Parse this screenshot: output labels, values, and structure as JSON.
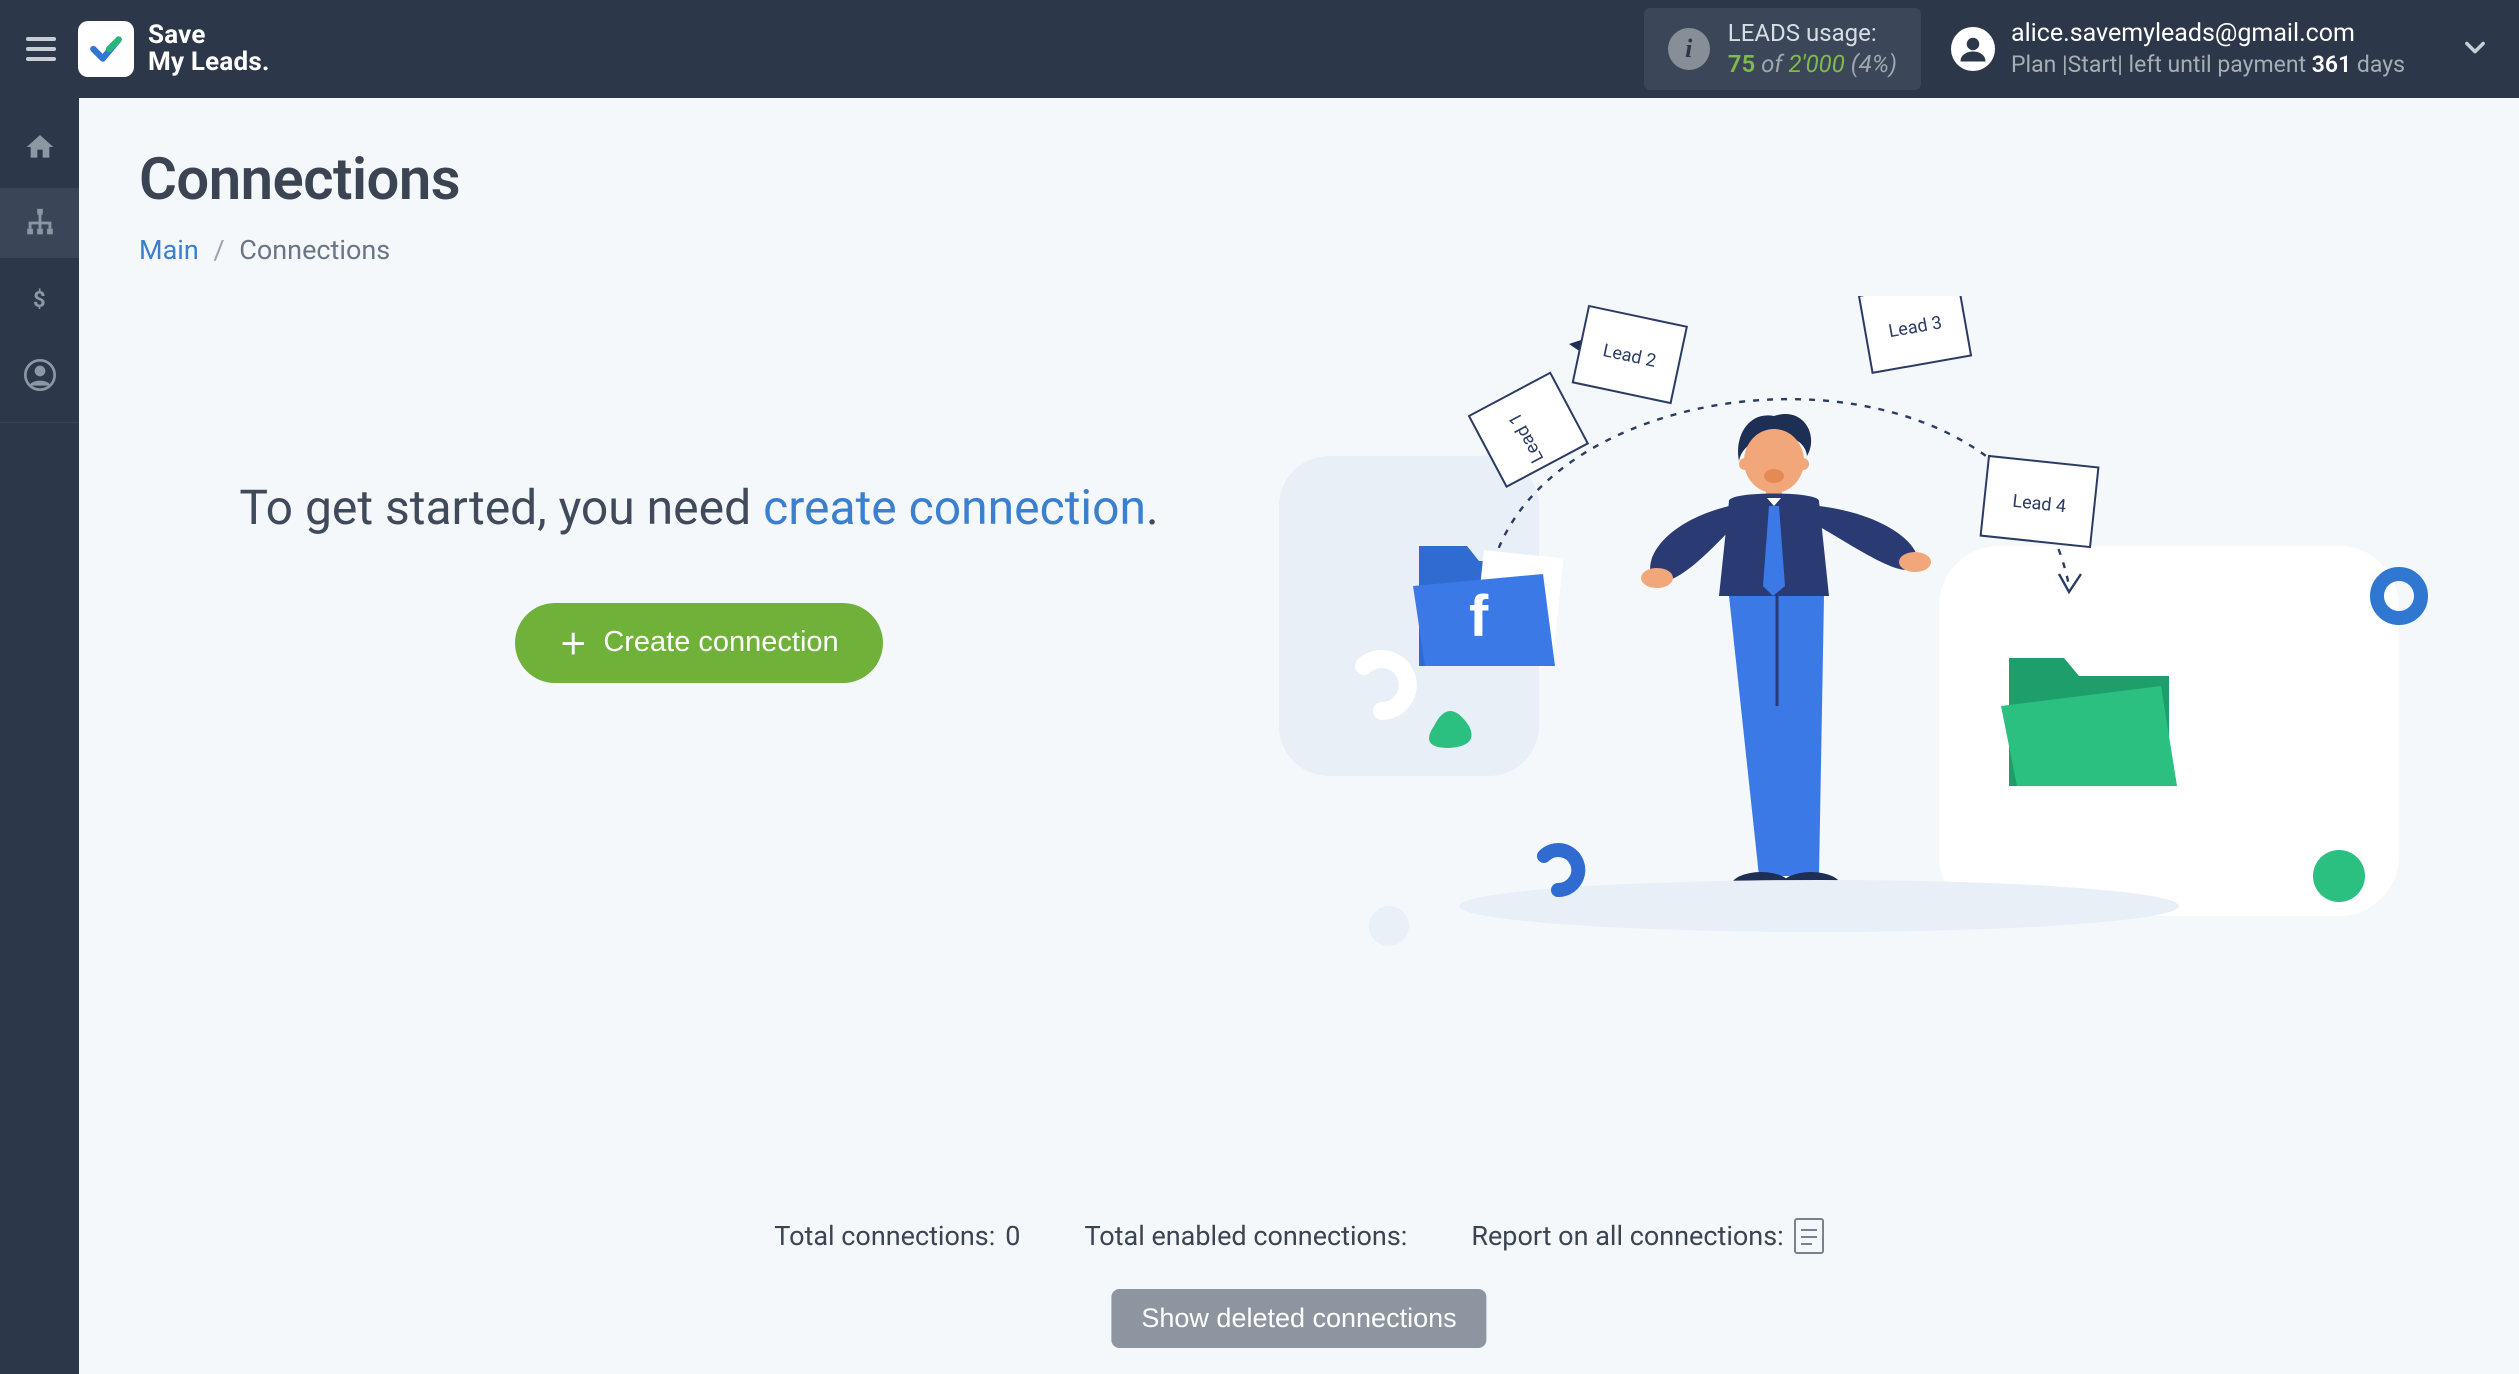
{
  "brand": {
    "line1": "Save",
    "line2": "My Leads."
  },
  "leads_usage": {
    "label": "LEADS usage:",
    "used": "75",
    "of": "of",
    "total": "2'000",
    "pct": "(4%)"
  },
  "account": {
    "email": "alice.savemyleads@gmail.com",
    "plan_prefix": "Plan  |",
    "plan_name": "Start",
    "plan_mid": "|  left until payment ",
    "days": "361",
    "days_suffix": " days"
  },
  "page": {
    "title": "Connections",
    "breadcrumb_main": "Main",
    "breadcrumb_current": "Connections"
  },
  "hero": {
    "prefix": "To get started, you need ",
    "link": "create connection",
    "suffix": ".",
    "button": "Create connection"
  },
  "illus": {
    "lead1": "Lead 1",
    "lead2": "Lead 2",
    "lead3": "Lead 3",
    "lead4": "Lead 4"
  },
  "stats": {
    "total_label": "Total connections: ",
    "total_value": "0",
    "enabled_label": "Total enabled connections:",
    "report_label": "Report on all connections:"
  },
  "show_deleted": "Show deleted connections"
}
